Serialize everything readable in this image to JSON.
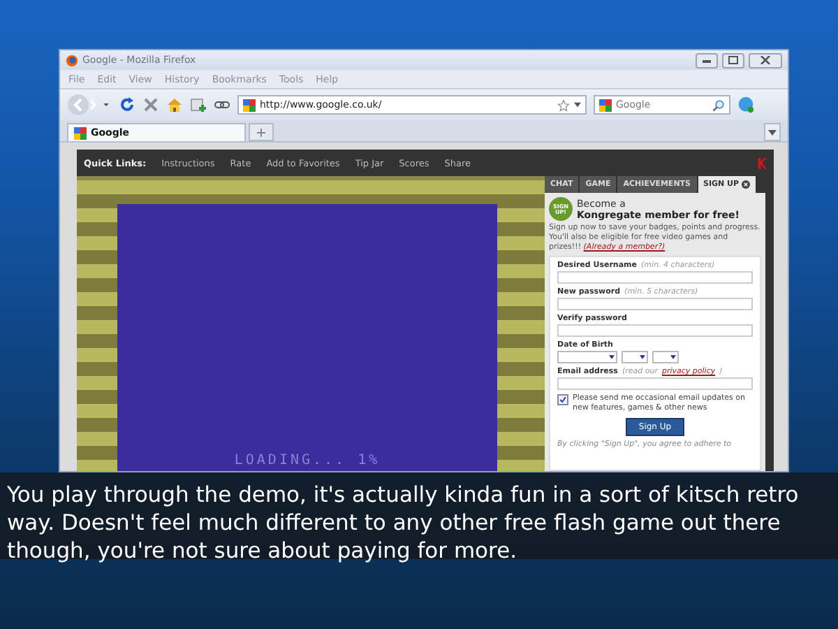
{
  "window": {
    "title": "Google - Mozilla Firefox"
  },
  "menu": [
    "File",
    "Edit",
    "View",
    "History",
    "Bookmarks",
    "Tools",
    "Help"
  ],
  "address": {
    "url": "http://www.google.co.uk/"
  },
  "search": {
    "placeholder": "Google"
  },
  "tabs": [
    {
      "label": "Google",
      "selected": true
    }
  ],
  "page": {
    "quick_links_label": "Quick Links:",
    "quick_links": [
      "Instructions",
      "Rate",
      "Add to Favorites",
      "Tip Jar",
      "Scores",
      "Share"
    ],
    "game": {
      "loading": "LOADING... 1%"
    },
    "sidebar": {
      "tabs": [
        {
          "label": "CHAT",
          "selected": false
        },
        {
          "label": "GAME",
          "selected": false
        },
        {
          "label": "ACHIEVEMENTS",
          "selected": false
        },
        {
          "label": "SIGN UP",
          "selected": true
        }
      ],
      "badge": "SIGN UP!",
      "heading_1": "Become a",
      "heading_2": "Kongregate member for free!",
      "intro": "Sign up now to save your badges, points and progress. You'll also be eligible for free video games and prizes!!!",
      "member_link": "(Already a member?)",
      "fields": [
        {
          "kind": "text",
          "label": "Desired Username",
          "hint": "(min. 4 characters)"
        },
        {
          "kind": "text",
          "label": "New password",
          "hint": "(min. 5 characters)"
        },
        {
          "kind": "text",
          "label": "Verify password"
        },
        {
          "kind": "date",
          "label": "Date of Birth"
        },
        {
          "kind": "text",
          "label": "Email address",
          "hint": "(read our",
          "link": "privacy policy",
          "hint_end": ")"
        }
      ],
      "newsletter": {
        "checked": true,
        "label": "Please send me occasional email updates on new features, games & other news"
      },
      "button": "Sign Up",
      "terms": "By clicking \"Sign Up\", you agree to adhere to"
    }
  },
  "caption": "You play through the demo, it's actually kinda fun in a sort of kitsch retro way. Doesn't feel much different to any other free flash game out there though, you're not sure about paying for more."
}
